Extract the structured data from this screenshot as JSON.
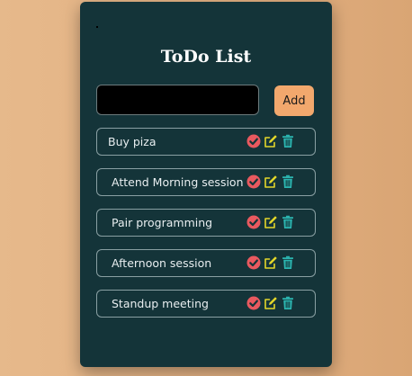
{
  "app": {
    "title": "ToDo List",
    "input_placeholder": "",
    "input_value": "",
    "add_label": "Add"
  },
  "todos": [
    {
      "text": "Buy piza"
    },
    {
      "text": "Attend Morning session"
    },
    {
      "text": "Pair programming"
    },
    {
      "text": "Afternoon session"
    },
    {
      "text": "Standup meeting"
    }
  ],
  "icons": {
    "complete": "check-circle-icon",
    "edit": "edit-icon",
    "delete": "trash-icon"
  },
  "colors": {
    "card_bg": "#143439",
    "accent": "#f2a86d",
    "complete": "#e8595f",
    "edit": "#e3d72a",
    "delete": "#2bb5b0"
  }
}
